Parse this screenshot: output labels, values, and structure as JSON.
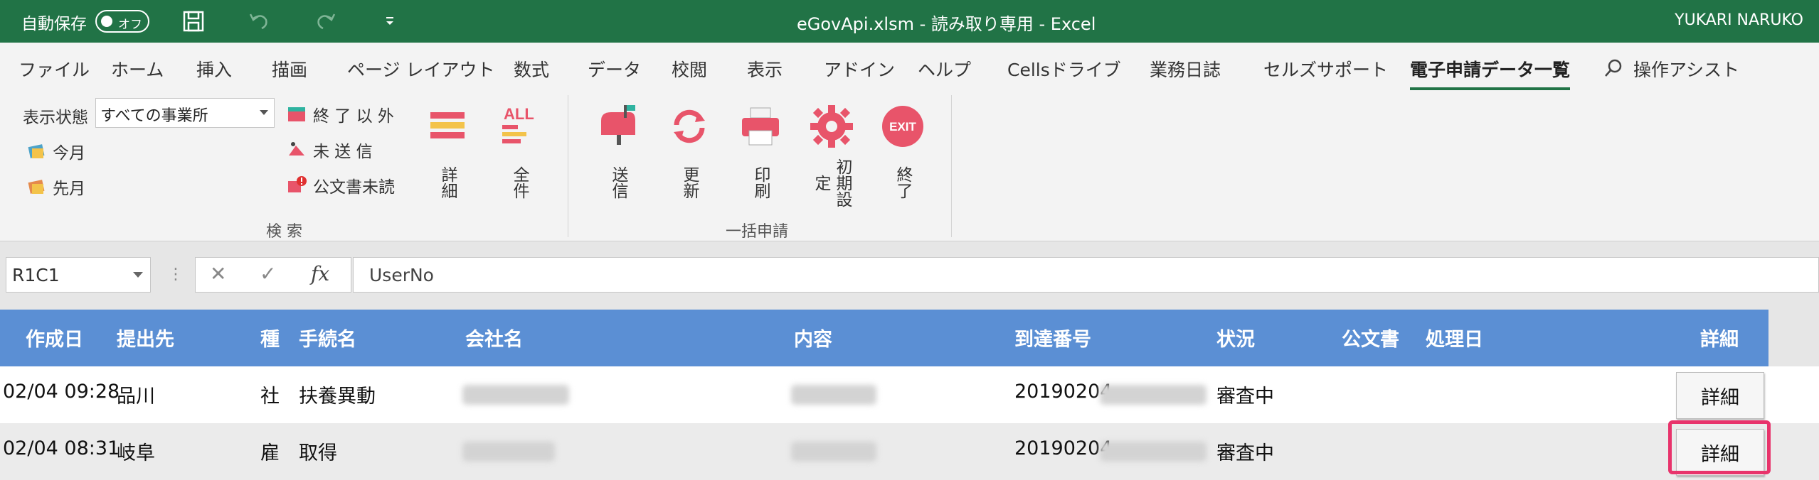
{
  "titlebar": {
    "autosave_label": "自動保存",
    "autosave_state": "オフ",
    "title": "eGovApi.xlsm  -  読み取り専用  -  Excel",
    "user": "YUKARI NARUKO"
  },
  "tabs": [
    "ファイル",
    "ホーム",
    "挿入",
    "描画",
    "ページ レイアウト",
    "数式",
    "データ",
    "校閲",
    "表示",
    "アドイン",
    "ヘルプ",
    "Cellsドライブ",
    "業務日誌",
    "セルズサポート",
    "電子申請データ一覧",
    "操作アシスト"
  ],
  "ribbon": {
    "display_state_label": "表示状態",
    "display_state_value": "すべての事業所",
    "this_month": "今月",
    "last_month": "先月",
    "finished": "終 了 以 外",
    "unsent": "未 送 信",
    "unread": "公文書未読",
    "detail": "詳細",
    "all": "全件",
    "send": "送信",
    "update": "更新",
    "print": "印刷",
    "initial_settings": "初期設定",
    "exit": "終了",
    "exit_badge": "EXIT",
    "all_badge": "ALL",
    "group_search": "検 索",
    "group_bulk": "一括申請"
  },
  "formulabar": {
    "namebox": "R1C1",
    "formula": "UserNo"
  },
  "table": {
    "headers": [
      "作成日",
      "提出先",
      "種",
      "手続名",
      "会社名",
      "内容",
      "到達番号",
      "状況",
      "公文書",
      "処理日",
      "詳細"
    ],
    "rows": [
      {
        "date": "02/04 09:28",
        "dest": "品川",
        "kind": "社",
        "procedure": "扶養異動",
        "arrival": "20190204",
        "status": "審査中",
        "button": "詳細"
      },
      {
        "date": "02/04 08:31",
        "dest": "岐阜",
        "kind": "雇",
        "procedure": "取得",
        "arrival": "20190204",
        "status": "審査中",
        "button": "詳細"
      }
    ]
  },
  "colors": {
    "excel_green": "#217346",
    "header_blue": "#5b8fd4",
    "highlight": "#e8336b"
  }
}
